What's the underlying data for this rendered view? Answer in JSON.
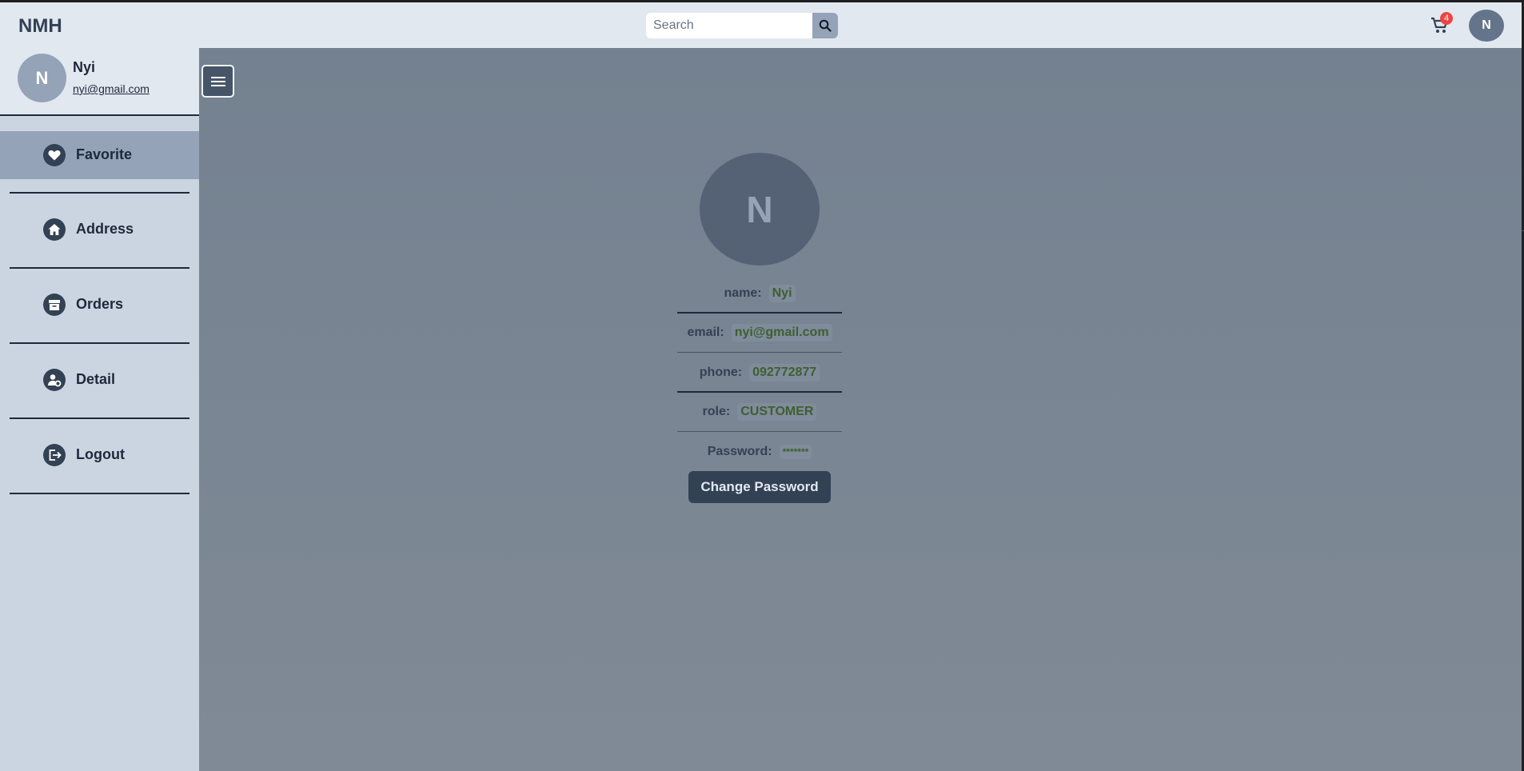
{
  "header": {
    "brand": "NMH",
    "search_placeholder": "Search",
    "cart_count": "4",
    "avatar_initial": "N"
  },
  "sidebar": {
    "user": {
      "initial": "N",
      "name": "Nyi",
      "email": "nyi@gmail.com"
    },
    "items": [
      {
        "label": "Favorite",
        "icon": "heart-icon",
        "active": true
      },
      {
        "label": "Address",
        "icon": "home-icon",
        "active": false
      },
      {
        "label": "Orders",
        "icon": "archive-icon",
        "active": false
      },
      {
        "label": "Detail",
        "icon": "user-gear-icon",
        "active": false
      },
      {
        "label": "Logout",
        "icon": "logout-icon",
        "active": false
      }
    ]
  },
  "profile": {
    "initial": "N",
    "fields": [
      {
        "key": "name:",
        "value": "Nyi"
      },
      {
        "key": "email:",
        "value": "nyi@gmail.com"
      },
      {
        "key": "phone:",
        "value": "092772877"
      },
      {
        "key": "role:",
        "value": "CUSTOMER"
      },
      {
        "key": "Password:",
        "value": "*******"
      }
    ],
    "change_password_label": "Change Password"
  },
  "colors": {
    "accent": "#334155",
    "active_nav": "#94a3b8",
    "badge": "#ef4444",
    "value_text": "#3f5f2f"
  }
}
